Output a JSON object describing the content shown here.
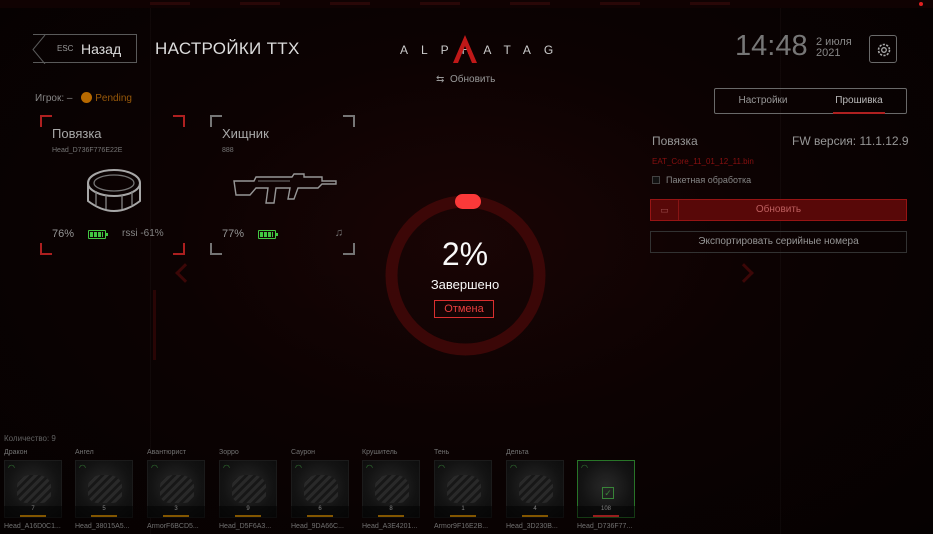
{
  "header": {
    "back_esc": "ESC",
    "back_label": "Назад",
    "title": "НАСТРОЙКИ ТТХ",
    "logo_text": "ALPHATAG",
    "refresh_label": "Обновить",
    "time": "14:48",
    "date_day": "2 июля",
    "date_year": "2021"
  },
  "player": {
    "label": "Игрок:",
    "dash": "–",
    "status": "Pending"
  },
  "cards": [
    {
      "name": "Повязка",
      "id": "Head_D736F776E22E",
      "battery": "76%",
      "rssi": "rssi -61%",
      "battery_level": 1.0
    },
    {
      "name": "Хищник",
      "id": "888",
      "battery": "77%",
      "battery_level": 1.0
    }
  ],
  "progress": {
    "percent_text": "2%",
    "percent_value": 0.02,
    "status": "Завершено",
    "cancel_label": "Отмена"
  },
  "panel": {
    "tabs": [
      "Настройки",
      "Прошивка"
    ],
    "active_tab": "Прошивка",
    "device": "Повязка",
    "fw_version": "FW версия: 11.1.12.9",
    "file": "EAT_Core_11_01_12_11.bin",
    "batch_label": "Пакетная обработка",
    "update_label": "Обновить",
    "export_label": "Экспортировать серийные номера"
  },
  "strip": {
    "qty_label": "Количество: 9",
    "tiles": [
      {
        "name": "Дракон",
        "id": "Head_A16D0C1...",
        "count": "7"
      },
      {
        "name": "Ангел",
        "id": "Head_38015A5...",
        "count": "5"
      },
      {
        "name": "Авантюрист",
        "id": "ArmorF6BCD5...",
        "count": "3"
      },
      {
        "name": "Зорро",
        "id": "Head_D5F6A3...",
        "count": "9"
      },
      {
        "name": "Саурон",
        "id": "Head_9DA66C...",
        "count": "6"
      },
      {
        "name": "Крушитель",
        "id": "Head_A3E4201...",
        "count": "8"
      },
      {
        "name": "Тень",
        "id": "Armor9F16E2B...",
        "count": "1"
      },
      {
        "name": "Дельта",
        "id": "Head_3D230B...",
        "count": "4"
      },
      {
        "name": "",
        "id": "Head_D736F77...",
        "count": "108"
      }
    ]
  },
  "colors": {
    "accent": "#e02a2a",
    "battery": "#44cc44",
    "pending": "#b86a00"
  }
}
